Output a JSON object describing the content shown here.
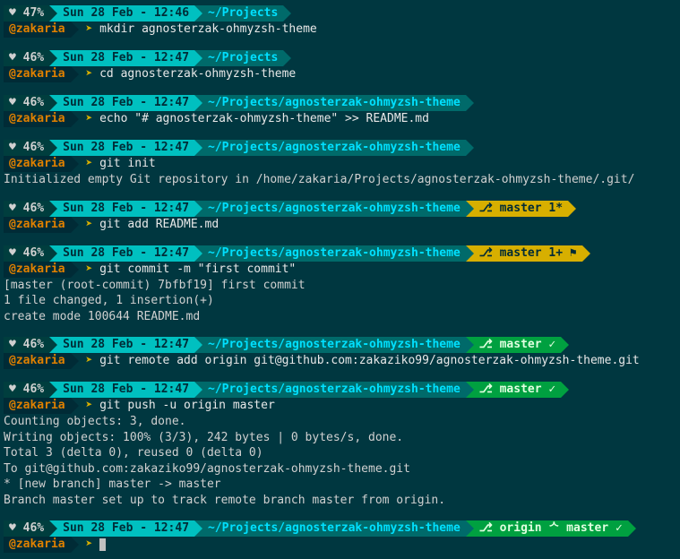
{
  "colors": {
    "bg": "#003740",
    "battery_bg": "#003e3e",
    "time_bg": "#00c0c0",
    "path_bg": "#006a6a",
    "path_fg": "#00e0ff",
    "git_dirty_bg": "#d7af00",
    "git_clean_bg": "#00a040",
    "user_bg": "#002b36",
    "user_fg": "#e08000",
    "caret_fg": "#d7af00"
  },
  "user": "@zakaria",
  "caret": "➤",
  "heart": "♥",
  "blocks": [
    {
      "battery": "47%",
      "time": "Sun 28 Feb - 12:46",
      "path": "~/Projects",
      "git": null,
      "command": "mkdir agnosterzak-ohmyzsh-theme",
      "output": []
    },
    {
      "battery": "46%",
      "time": "Sun 28 Feb - 12:47",
      "path": "~/Projects",
      "git": null,
      "command": "cd agnosterzak-ohmyzsh-theme",
      "output": []
    },
    {
      "battery": "46%",
      "time": "Sun 28 Feb - 12:47",
      "path": "~/Projects/agnosterzak-ohmyzsh-theme",
      "git": null,
      "command": "echo \"# agnosterzak-ohmyzsh-theme\" >> README.md",
      "output": []
    },
    {
      "battery": "46%",
      "time": "Sun 28 Feb - 12:47",
      "path": "~/Projects/agnosterzak-ohmyzsh-theme",
      "git": null,
      "command": "git init",
      "output": [
        "Initialized empty Git repository in /home/zakaria/Projects/agnosterzak-ohmyzsh-theme/.git/"
      ]
    },
    {
      "battery": "46%",
      "time": "Sun 28 Feb - 12:47",
      "path": "~/Projects/agnosterzak-ohmyzsh-theme",
      "git": {
        "label": "master 1*",
        "clean": false
      },
      "command": "git add README.md",
      "output": []
    },
    {
      "battery": "46%",
      "time": "Sun 28 Feb - 12:47",
      "path": "~/Projects/agnosterzak-ohmyzsh-theme",
      "git": {
        "label": "master 1+ ⚑",
        "clean": false
      },
      "command": "git commit -m \"first commit\"",
      "output": [
        "[master (root-commit) 7bfbf19] first commit",
        " 1 file changed, 1 insertion(+)",
        " create mode 100644 README.md"
      ]
    },
    {
      "battery": "46%",
      "time": "Sun 28 Feb - 12:47",
      "path": "~/Projects/agnosterzak-ohmyzsh-theme",
      "git": {
        "label": "master ✓",
        "clean": true
      },
      "command": "git remote add origin git@github.com:zakaziko99/agnosterzak-ohmyzsh-theme.git",
      "output": []
    },
    {
      "battery": "46%",
      "time": "Sun 28 Feb - 12:47",
      "path": "~/Projects/agnosterzak-ohmyzsh-theme",
      "git": {
        "label": "master ✓",
        "clean": true
      },
      "command": "git push -u origin master",
      "output": [
        "Counting objects: 3, done.",
        "Writing objects: 100% (3/3), 242 bytes | 0 bytes/s, done.",
        "Total 3 (delta 0), reused 0 (delta 0)",
        "To git@github.com:zakaziko99/agnosterzak-ohmyzsh-theme.git",
        " * [new branch]      master -> master",
        "Branch master set up to track remote branch master from origin."
      ]
    },
    {
      "battery": "46%",
      "time": "Sun 28 Feb - 12:47",
      "path": "~/Projects/agnosterzak-ohmyzsh-theme",
      "git": {
        "label": "origin ᄉ master ✓",
        "clean": true
      },
      "command": "",
      "cursor": true,
      "output": []
    }
  ]
}
